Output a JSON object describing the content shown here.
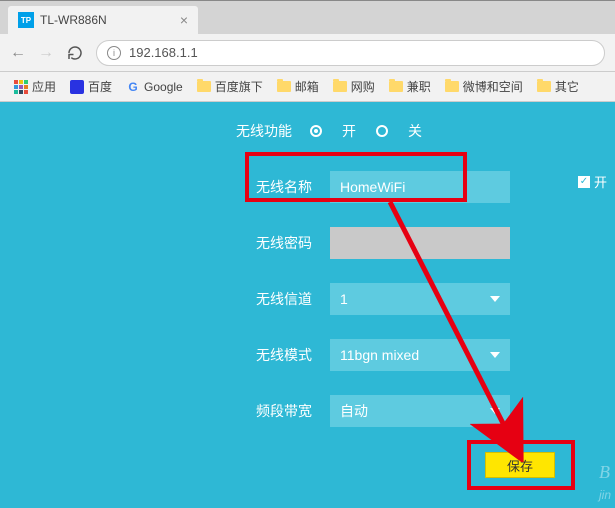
{
  "browser": {
    "tab_title": "TL-WR886N",
    "favicon_text": "TP",
    "url": "192.168.1.1",
    "bookmarks": {
      "apps": "应用",
      "baidu": "百度",
      "google": "Google",
      "items": [
        "百度旗下",
        "邮箱",
        "网购",
        "兼职",
        "微博和空间",
        "其它"
      ]
    }
  },
  "form": {
    "wireless_func": {
      "label": "无线功能",
      "on": "开",
      "off": "关"
    },
    "ssid": {
      "label": "无线名称",
      "value": "HomeWiFi"
    },
    "password": {
      "label": "无线密码",
      "value": ""
    },
    "channel": {
      "label": "无线信道",
      "value": "1"
    },
    "mode": {
      "label": "无线模式",
      "value": "11bgn mixed"
    },
    "bandwidth": {
      "label": "频段带宽",
      "value": "自动"
    },
    "side_check": "开",
    "save": "保存"
  },
  "watermark": "B\njin"
}
